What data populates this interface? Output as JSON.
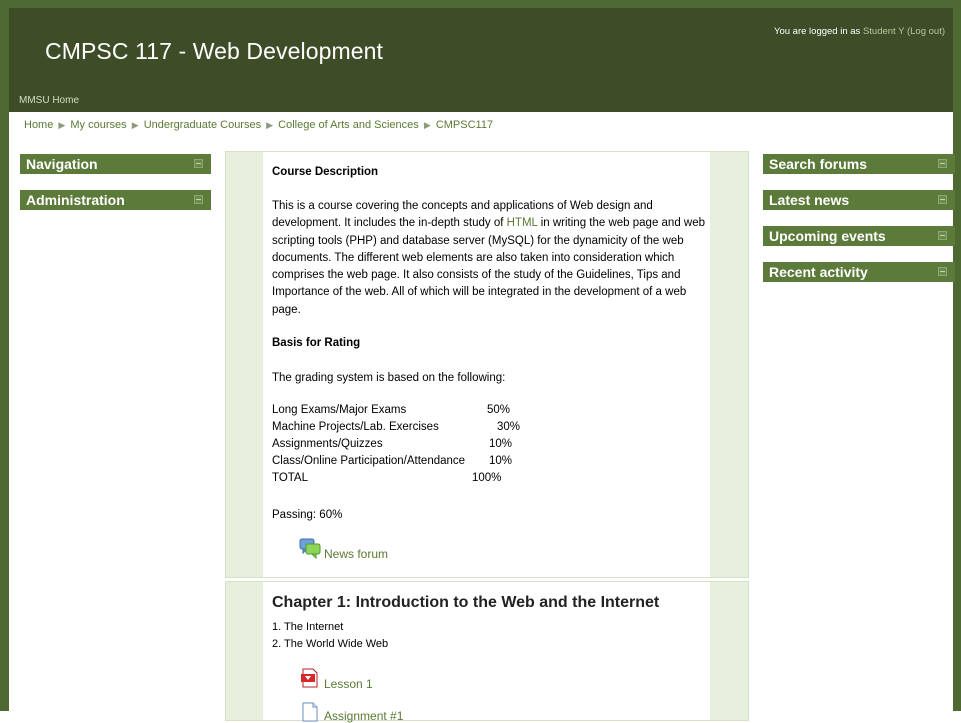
{
  "header": {
    "title": "CMPSC 117 - Web Development",
    "login_prefix": "You are logged in as ",
    "user_name": "Student Y",
    "logout_label": "(Log out)",
    "home_link": "MMSU Home"
  },
  "breadcrumb": {
    "items": [
      "Home",
      "My courses",
      "Undergraduate Courses",
      "College of Arts and Sciences",
      "CMPSC117"
    ],
    "separator": "▶"
  },
  "left_blocks": [
    "Navigation",
    "Administration"
  ],
  "right_blocks": [
    "Search forums",
    "Latest news",
    "Upcoming events",
    "Recent activity"
  ],
  "section0": {
    "heading": "Course Description",
    "desc_before_link": "This is a course covering the concepts and applications of Web design and development. It includes the in-depth study of ",
    "desc_link": "HTML",
    "desc_after_link": " in writing the web page and web scripting tools (PHP) and database server (MySQL) for the dynamicity of the web documents. The different web elements are also taken into consideration which comprises the web page. It also consists of the study of the Guidelines, Tips and Importance of the web. All of which will be integrated in the development of a web page.",
    "rating_heading": "Basis for Rating",
    "grading_intro": "The grading system is based on the following:",
    "grading": [
      {
        "label": "Long Exams/Major Exams",
        "pct": "50%"
      },
      {
        "label": "Machine Projects/Lab. Exercises",
        "pct": "30%"
      },
      {
        "label": "Assignments/Quizzes",
        "pct": "10%"
      },
      {
        "label": "Class/Online Participation/Attendance",
        "pct": "10%"
      },
      {
        "label": "TOTAL",
        "pct": "100%"
      }
    ],
    "passing": "Passing: 60%",
    "news_forum": "News forum"
  },
  "section1": {
    "title": "Chapter 1: Introduction to the Web and the Internet",
    "topics": [
      "1. The Internet",
      "2. The World Wide Web"
    ],
    "lesson": "Lesson 1",
    "assignment": "Assignment #1"
  },
  "colors": {
    "header_bg": "#3e4d28",
    "block_header": "#5c7a3a",
    "link": "#5a7a33",
    "frame": "#4e6a32"
  }
}
